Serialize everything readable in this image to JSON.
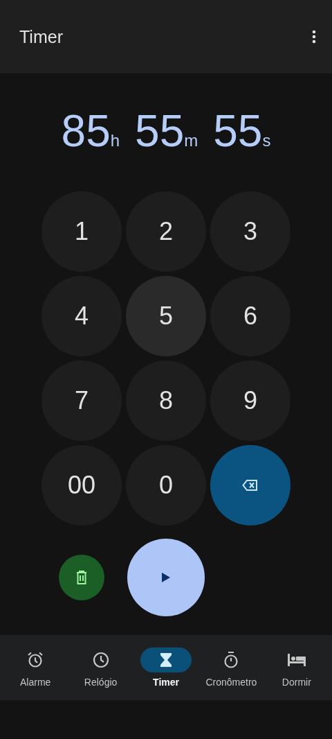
{
  "app_bar": {
    "title": "Timer"
  },
  "display": [
    {
      "value": "85",
      "unit": "h"
    },
    {
      "value": "55",
      "unit": "m"
    },
    {
      "value": "55",
      "unit": "s"
    }
  ],
  "keypad": [
    {
      "kind": "digit",
      "label": "1",
      "pressed": false
    },
    {
      "kind": "digit",
      "label": "2",
      "pressed": false
    },
    {
      "kind": "digit",
      "label": "3",
      "pressed": false
    },
    {
      "kind": "digit",
      "label": "4",
      "pressed": false
    },
    {
      "kind": "digit",
      "label": "5",
      "pressed": true
    },
    {
      "kind": "digit",
      "label": "6",
      "pressed": false
    },
    {
      "kind": "digit",
      "label": "7",
      "pressed": false
    },
    {
      "kind": "digit",
      "label": "8",
      "pressed": false
    },
    {
      "kind": "digit",
      "label": "9",
      "pressed": false
    },
    {
      "kind": "digit",
      "label": "00",
      "pressed": false
    },
    {
      "kind": "digit",
      "label": "0",
      "pressed": false
    },
    {
      "kind": "backspace",
      "pressed": false
    }
  ],
  "bottom_nav": [
    {
      "kind": "alarm",
      "label": "Alarme",
      "selected": false
    },
    {
      "kind": "clock",
      "label": "Relógio",
      "selected": false
    },
    {
      "kind": "timer",
      "label": "Timer",
      "selected": true
    },
    {
      "kind": "stopwatch",
      "label": "Cronômetro",
      "selected": false
    },
    {
      "kind": "sleep",
      "label": "Dormir",
      "selected": false
    }
  ]
}
